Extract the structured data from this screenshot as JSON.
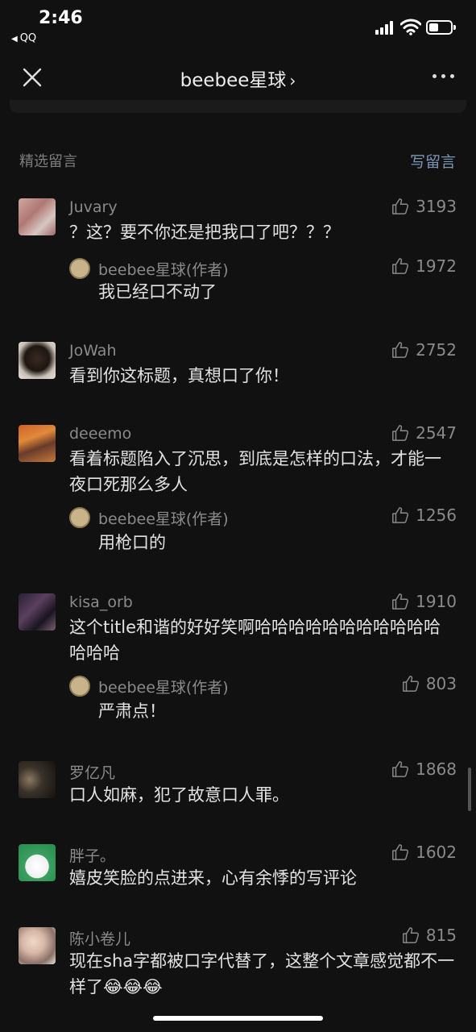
{
  "status_bar": {
    "time": "2:46",
    "back_app": "QQ"
  },
  "nav": {
    "title": "beebee星球",
    "chevron": "›"
  },
  "section": {
    "title": "精选留言",
    "write_label": "写留言"
  },
  "comments": [
    {
      "author": "Juvary",
      "likes": "3193",
      "text": "？这？要不你还是把我口了吧？？？",
      "reply": {
        "author": "beebee星球(作者)",
        "likes": "1972",
        "text": "我已经口不动了"
      }
    },
    {
      "author": "JoWah",
      "likes": "2752",
      "text": "看到你这标题，真想口了你！"
    },
    {
      "author": "deeemo",
      "likes": "2547",
      "text": "看着标题陷入了沉思，到底是怎样的口法，才能一夜口死那么多人",
      "reply": {
        "author": "beebee星球(作者)",
        "likes": "1256",
        "text": "用枪口的"
      }
    },
    {
      "author": "kisa_orb",
      "likes": "1910",
      "text": "这个title和谐的好好笑啊哈哈哈哈哈哈哈哈哈哈哈哈哈哈",
      "reply": {
        "author": "beebee星球(作者)",
        "likes": "803",
        "text": "严肃点！"
      }
    },
    {
      "author": "罗亿凡",
      "likes": "1868",
      "text": "口人如麻，犯了故意口人罪。"
    },
    {
      "author": "胖子。",
      "likes": "1602",
      "text": "嬉皮笑脸的点进来，心有余悸的写评论"
    },
    {
      "author": "陈小卷儿",
      "likes": "815",
      "text": "现在sha字都被口字代替了，这整个文章感觉都不一样了😂😂😂"
    }
  ],
  "icons": {
    "like": "thumbs-up-icon",
    "close": "close-icon",
    "more": "more-icon",
    "wifi": "wifi-icon",
    "signal": "signal-icon",
    "battery": "battery-icon"
  },
  "colors": {
    "background": "#111111",
    "link": "#7a95b5",
    "muted": "#8a8a8a",
    "text": "#e2e2e2"
  }
}
